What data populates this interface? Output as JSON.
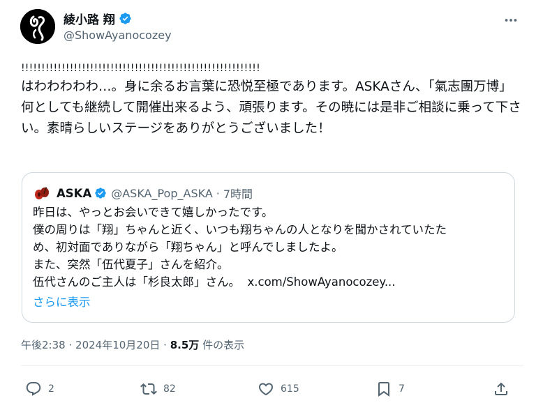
{
  "author": {
    "display_name": "綾小路 翔",
    "handle": "@ShowAyanocozey",
    "verified_icon": "verified-badge-icon"
  },
  "tweet": {
    "exclamations": "!!!!!!!!!!!!!!!!!!!!!!!!!!!!!!!!!!!!!!!!!!!!!!!!!!!!!!!!!!!",
    "text": "はわわわわわ…。身に余るお言葉に恐悦至極であります。ASKAさん、「氣志團万博」何としても継続して開催出来るよう、頑張ります。その暁には是非ご相談に乗って下さい。素晴らしいステージをありがとうございました！"
  },
  "quote": {
    "display_name": "ASKA",
    "handle": "@ASKA_Pop_ASKA",
    "separator": "·",
    "time": "7時間",
    "lines": [
      "昨日は、やっとお会いできて嬉しかったです。",
      "僕の周りは「翔」ちゃんと近く、いつも翔ちゃんの人となりを聞かされていたた",
      "め、初対面でありながら「翔ちゃん」と呼んでしましたよ。",
      "また、突然「伍代夏子」さんを紹介。",
      "伍代さんのご主人は「杉良太郎」さん。"
    ],
    "link_text": "x.com/ShowAyanocozey...",
    "show_more": "さらに表示"
  },
  "meta": {
    "time": "午後2:38",
    "dot": "·",
    "date": "2024年10月20日",
    "dot2": "·",
    "views": "8.5万",
    "views_label": "件の表示"
  },
  "actions": {
    "replies": "2",
    "retweets": "82",
    "likes": "615",
    "bookmarks": "7"
  },
  "colors": {
    "accent": "#1d9bf0",
    "secondary_text": "#536471",
    "border": "#cfd9de"
  }
}
